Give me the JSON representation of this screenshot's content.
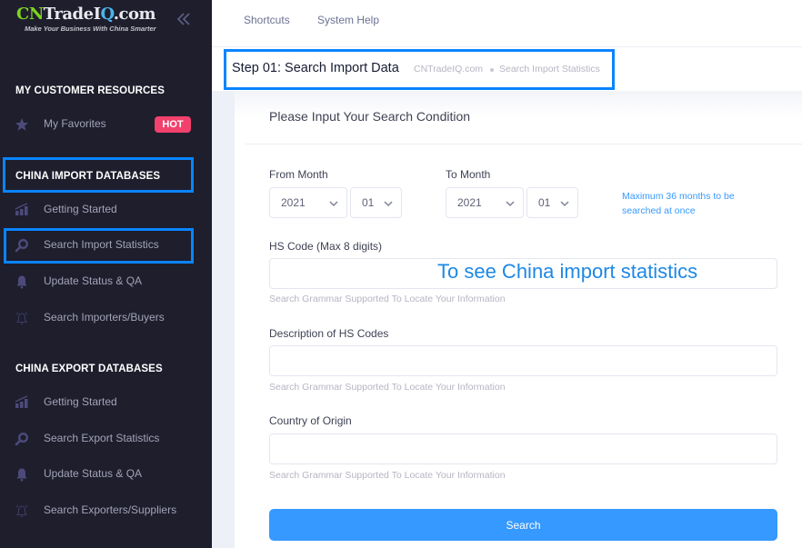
{
  "sidebar": {
    "logo": {
      "part_cn": "CN",
      "part_trade": "Trade",
      "part_i": "I",
      "part_q": "Q",
      "part_com": ".com",
      "tagline": "Make Your Business With China Smarter"
    },
    "collapse_icon": "double-chevron-left-icon",
    "sections": [
      {
        "title": "MY CUSTOMER RESOURCES",
        "items": [
          {
            "label": "My Favorites",
            "icon": "star-icon",
            "badge": "HOT"
          }
        ]
      },
      {
        "title": "CHINA IMPORT DATABASES",
        "items": [
          {
            "label": "Getting Started",
            "icon": "chart-bars-icon"
          },
          {
            "label": "Search Import Statistics",
            "icon": "search-icon"
          },
          {
            "label": "Update Status & QA",
            "icon": "bell-icon"
          },
          {
            "label": "Search Importers/Buyers",
            "icon": "alarm-icon"
          }
        ]
      },
      {
        "title": "CHINA EXPORT DATABASES",
        "items": [
          {
            "label": "Getting Started",
            "icon": "chart-bars-icon"
          },
          {
            "label": "Search Export Statistics",
            "icon": "search-icon"
          },
          {
            "label": "Update Status & QA",
            "icon": "bell-icon"
          },
          {
            "label": "Search Exporters/Suppliers",
            "icon": "alarm-icon"
          }
        ]
      }
    ]
  },
  "topbar": {
    "links": [
      "Shortcuts",
      "System Help"
    ]
  },
  "subheader": {
    "title": "Step 01: Search Import Data",
    "breadcrumb": [
      "CNTradeIQ.com",
      "Search Import Statistics"
    ]
  },
  "form": {
    "title": "Please Input Your Search Condition",
    "from_month": {
      "label": "From Month",
      "year": "2021",
      "month": "01"
    },
    "to_month": {
      "label": "To Month",
      "year": "2021",
      "month": "01"
    },
    "range_note": "Maximum 36 months to be searched at once",
    "fields": [
      {
        "label": "HS Code (Max 8 digits)",
        "value": "",
        "help": "Search Grammar Supported To Locate Your Information"
      },
      {
        "label": "Description of HS Codes",
        "value": "",
        "help": "Search Grammar Supported To Locate Your Information"
      },
      {
        "label": "Country of Origin",
        "value": "",
        "help": "Search Grammar Supported To Locate Your Information"
      }
    ],
    "annotation": "To see China import statistics",
    "search_label": "Search"
  },
  "colors": {
    "sidebar_bg": "#1e1e2d",
    "accent": "#3699ff",
    "highlight_border": "#0a84ff",
    "hot_badge": "#f1416c",
    "annotation_text": "#1e88e5"
  }
}
